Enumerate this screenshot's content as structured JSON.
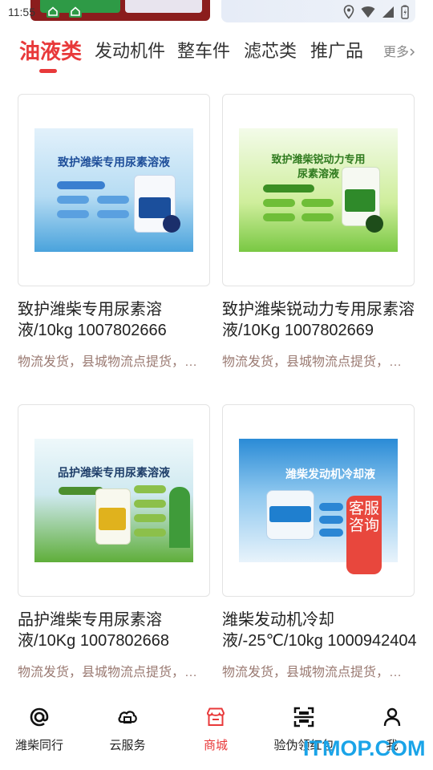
{
  "status_bar": {
    "time": "11:55"
  },
  "tabs": [
    {
      "label": "油液类",
      "active": true
    },
    {
      "label": "发动机件",
      "active": false
    },
    {
      "label": "整车件",
      "active": false
    },
    {
      "label": "滤芯类",
      "active": false
    },
    {
      "label": "推广品",
      "active": false
    }
  ],
  "more_label": "更多",
  "more_icon": "chevron-right-icon",
  "products": [
    {
      "title": "致护潍柴专用尿素溶液/10kg 1007802666",
      "desc": "物流发货，县城物流点提货，送到家需要补差价",
      "image_text": "致护潍柴专用尿素溶液"
    },
    {
      "title": "致护潍柴锐动力专用尿素溶液/10Kg 1007802669",
      "desc": "物流发货，县城物流点提货，送到家需要补差价",
      "image_text": "致护潍柴锐动力专用尿素溶液"
    },
    {
      "title": "品护潍柴专用尿素溶液/10Kg 1007802668",
      "desc": "物流发货，县城物流点提货，送到家需要补差价",
      "image_text": "品护潍柴专用尿素溶液"
    },
    {
      "title": "潍柴发动机冷却液/-25℃/10kg 1000942404",
      "desc": "物流发货，县城物流点提货，送到家需要补差价",
      "image_text": "潍柴发动机冷却液"
    }
  ],
  "customer_service": "客服咨询",
  "bottom_nav": [
    {
      "label": "潍柴同行",
      "icon": "at-sign-icon",
      "active": false
    },
    {
      "label": "云服务",
      "icon": "cloud-service-icon",
      "active": false
    },
    {
      "label": "商城",
      "icon": "store-icon",
      "active": true
    },
    {
      "label": "验伪领红包",
      "icon": "scan-icon",
      "active": false
    },
    {
      "label": "我",
      "icon": "user-icon",
      "active": false
    }
  ],
  "watermark": "ITMOP.COM",
  "colors": {
    "accent": "#e8393a",
    "desc": "#9a7a72",
    "watermark": "#1aa4e8"
  }
}
